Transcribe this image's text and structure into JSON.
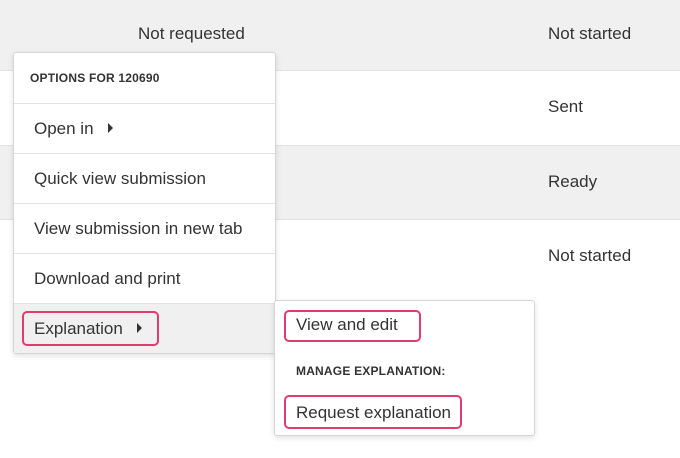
{
  "table": {
    "rows": [
      {
        "request_status": "Not requested",
        "status": "Not started"
      },
      {
        "request_status": "",
        "status": "Sent"
      },
      {
        "request_status": "",
        "status": "Ready"
      },
      {
        "request_status": "",
        "status": "Not started"
      }
    ]
  },
  "options_menu": {
    "header": "OPTIONS FOR 120690",
    "items": [
      {
        "label": "Open in",
        "has_submenu": true
      },
      {
        "label": "Quick view submission"
      },
      {
        "label": "View submission in new tab"
      },
      {
        "label": "Download and print"
      },
      {
        "label": "Explanation",
        "has_submenu": true,
        "highlighted": true
      }
    ]
  },
  "explanation_submenu": {
    "view_edit": "View and edit",
    "manage_header": "MANAGE EXPLANATION:",
    "request": "Request explanation"
  },
  "colors": {
    "highlight": "#e23c6e",
    "shaded_row": "#f0f0f0"
  }
}
